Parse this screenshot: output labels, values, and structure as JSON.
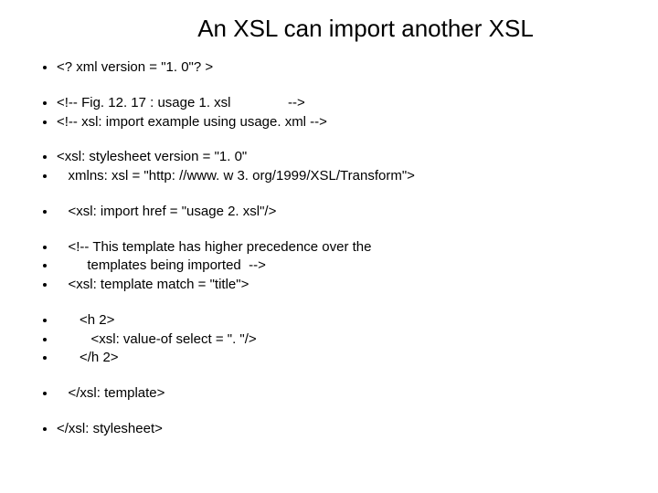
{
  "title": "An XSL can import another XSL",
  "lines": [
    "<? xml version = \"1. 0\"? >",
    "",
    "<!-- Fig. 12. 17 : usage 1. xsl               -->",
    "<!-- xsl: import example using usage. xml -->",
    "",
    "<xsl: stylesheet version = \"1. 0\"",
    "   xmlns: xsl = \"http: //www. w 3. org/1999/XSL/Transform\">",
    "",
    "   <xsl: import href = \"usage 2. xsl\"/>",
    "",
    "   <!-- This template has higher precedence over the",
    "        templates being imported  -->",
    "   <xsl: template match = \"title\">",
    "",
    "      <h 2>",
    "         <xsl: value-of select = \". \"/>",
    "      </h 2>",
    "",
    "   </xsl: template>",
    "",
    "</xsl: stylesheet>"
  ]
}
